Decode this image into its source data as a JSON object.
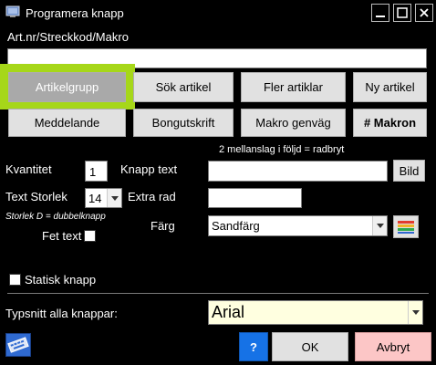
{
  "window": {
    "title": "Programera knapp"
  },
  "code": {
    "label": "Art.nr/Streckkod/Makro",
    "value": ""
  },
  "buttons_row1": [
    {
      "label": "Artikelgrupp"
    },
    {
      "label": "Sök artikel"
    },
    {
      "label": "Fler artiklar"
    },
    {
      "label": "Ny artikel"
    }
  ],
  "buttons_row2": [
    {
      "label": "Meddelande"
    },
    {
      "label": "Bongutskrift"
    },
    {
      "label": "Makro genväg"
    },
    {
      "label": "# Makron"
    }
  ],
  "hint": "2 mellanslag i följd = radbryt",
  "quantity": {
    "label": "Kvantitet",
    "value": "1"
  },
  "button_text": {
    "label": "Knapp text",
    "value": "",
    "image_button": "Bild"
  },
  "text_size": {
    "label": "Text Storlek",
    "value": "14",
    "note": "Storlek D = dubbelknapp"
  },
  "extra_row": {
    "label": "Extra rad",
    "value": ""
  },
  "color": {
    "label": "Färg",
    "value": "Sandfärg"
  },
  "bold": {
    "label": "Fet text"
  },
  "static": {
    "label": "Statisk knapp"
  },
  "font": {
    "label": "Typsnitt alla knappar:",
    "value": "Arial"
  },
  "footer": {
    "help": "?",
    "ok": "OK",
    "cancel": "Avbryt"
  },
  "colors": {
    "highlight": "#a6d719",
    "help_blue": "#1672e6",
    "cancel_pink": "#fcc6c6",
    "font_field": "#ffffe0"
  }
}
